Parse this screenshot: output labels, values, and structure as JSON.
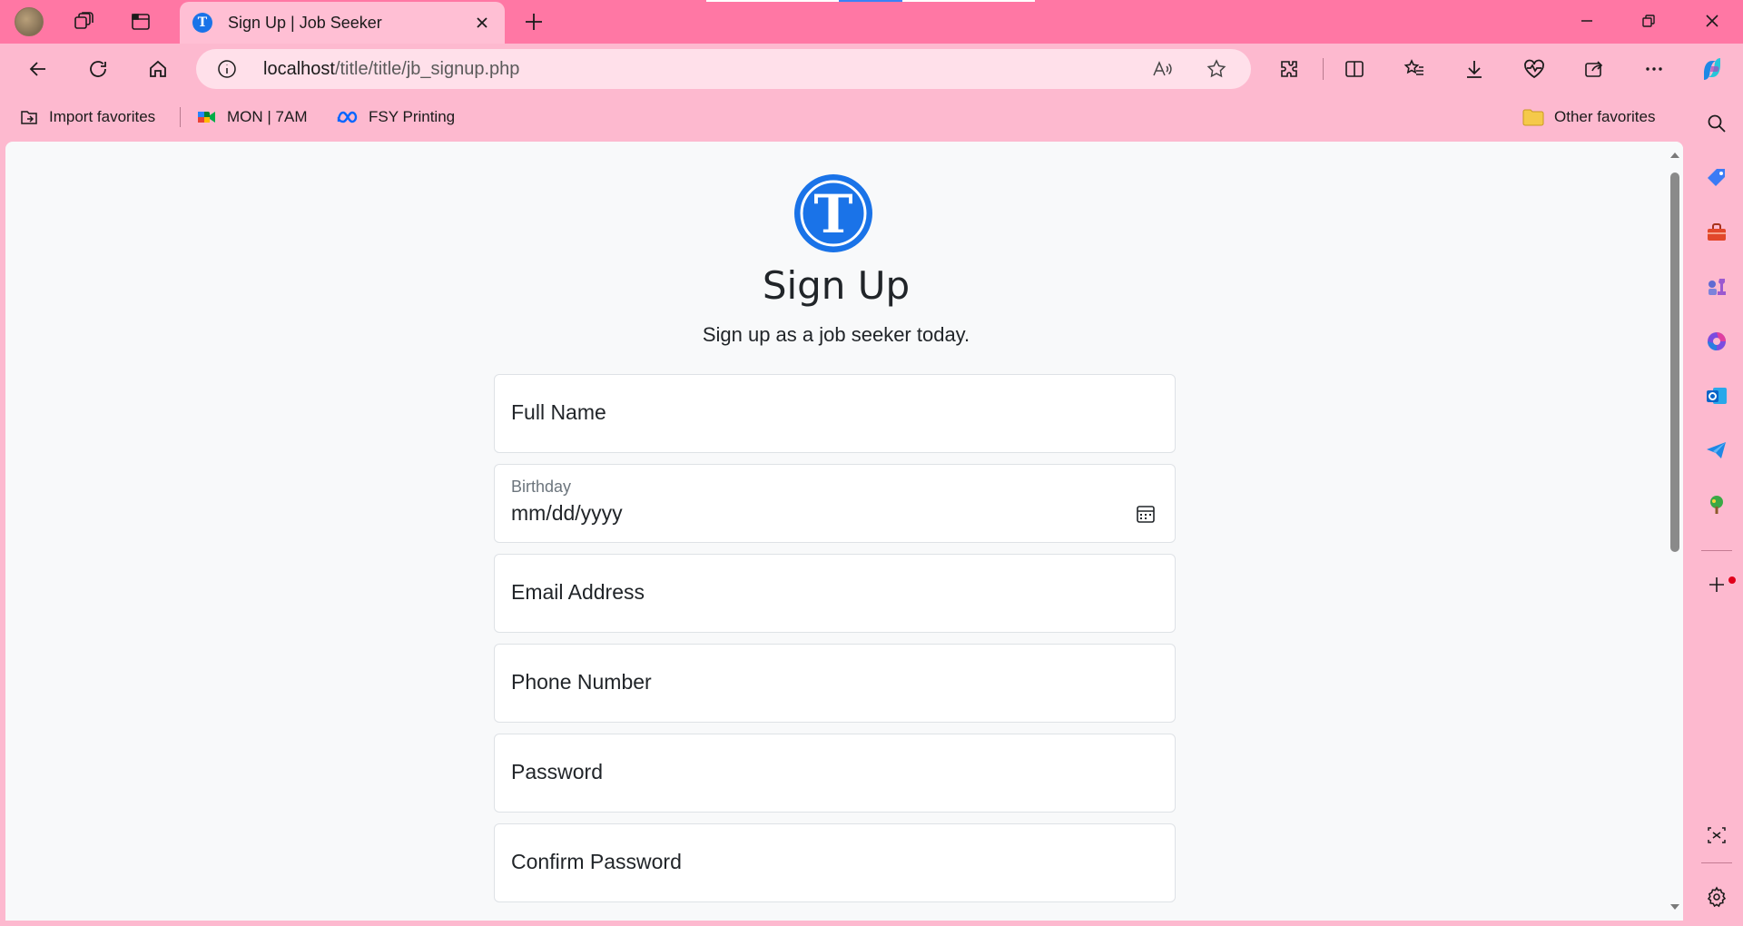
{
  "browser": {
    "tab": {
      "title": "Sign Up | Job Seeker",
      "favicon_letter": "T"
    },
    "address": {
      "host": "localhost",
      "path": "/title/title/jb_signup.php"
    },
    "favorites": [
      {
        "label": "Import favorites",
        "icon": "import-favorites-icon"
      },
      {
        "label": "MON | 7AM",
        "icon": "google-meet-icon"
      },
      {
        "label": "FSY Printing",
        "icon": "meta-icon"
      }
    ],
    "other_favorites": "Other favorites",
    "colors": {
      "titlebar": "#ff77a4",
      "toolbar": "#fdb9cf",
      "tab_active": "#ffbfd4",
      "addressbar": "#ffe0ea"
    }
  },
  "page": {
    "logo_letter": "T",
    "title": "Sign Up",
    "subtitle": "Sign up as a job seeker today.",
    "fields": {
      "full_name": {
        "placeholder": "Full Name"
      },
      "birthday": {
        "label": "Birthday",
        "value": "mm/dd/yyyy"
      },
      "email": {
        "placeholder": "Email Address"
      },
      "phone": {
        "placeholder": "Phone Number"
      },
      "password": {
        "placeholder": "Password"
      },
      "confirm_password": {
        "placeholder": "Confirm Password"
      }
    },
    "colors": {
      "brand": "#1a73e8",
      "background": "#f8f9fa"
    }
  }
}
